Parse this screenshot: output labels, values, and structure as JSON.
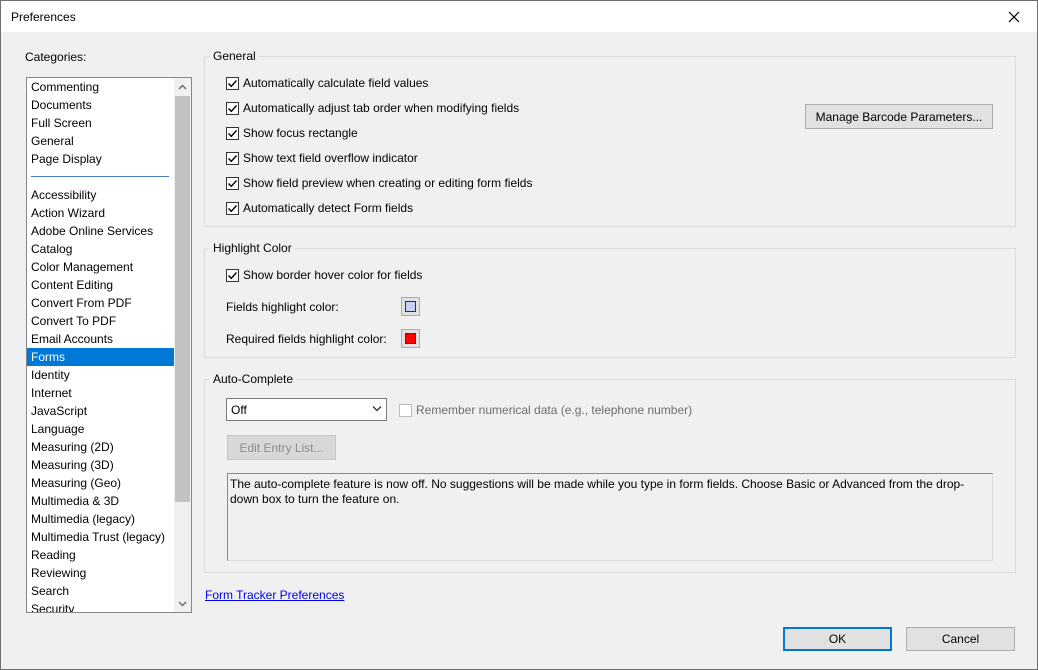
{
  "window": {
    "title": "Preferences"
  },
  "categories": {
    "label": "Categories:",
    "group1": [
      "Commenting",
      "Documents",
      "Full Screen",
      "General",
      "Page Display"
    ],
    "group2": [
      "Accessibility",
      "Action Wizard",
      "Adobe Online Services",
      "Catalog",
      "Color Management",
      "Content Editing",
      "Convert From PDF",
      "Convert To PDF",
      "Email Accounts",
      "Forms",
      "Identity",
      "Internet",
      "JavaScript",
      "Language",
      "Measuring (2D)",
      "Measuring (3D)",
      "Measuring (Geo)",
      "Multimedia & 3D",
      "Multimedia (legacy)",
      "Multimedia Trust (legacy)",
      "Reading",
      "Reviewing",
      "Search",
      "Security"
    ],
    "selected": "Forms"
  },
  "general": {
    "title": "General",
    "options": [
      {
        "label": "Automatically calculate field values",
        "checked": true
      },
      {
        "label": "Automatically adjust tab order when modifying fields",
        "checked": true
      },
      {
        "label": "Show focus rectangle",
        "checked": true
      },
      {
        "label": "Show text field overflow indicator",
        "checked": true
      },
      {
        "label": "Show field preview when creating or editing form fields",
        "checked": true
      },
      {
        "label": "Automatically detect Form fields",
        "checked": true
      }
    ],
    "barcode_button": "Manage Barcode Parameters..."
  },
  "highlight": {
    "title": "Highlight Color",
    "border_hover_label": "Show border hover color for fields",
    "border_hover_checked": true,
    "fields_color_label": "Fields highlight color:",
    "fields_color": "#c6d2f5",
    "required_color_label": "Required fields highlight color:",
    "required_color": "#ff0000"
  },
  "autocomplete": {
    "title": "Auto-Complete",
    "mode": "Off",
    "remember_label": "Remember numerical data (e.g., telephone number)",
    "remember_checked": false,
    "edit_button": "Edit Entry List...",
    "description": "The auto-complete feature is now off. No suggestions will be made while you type in form fields. Choose Basic or Advanced from the drop-down box to turn the feature on."
  },
  "form_tracker_link": "Form Tracker Preferences",
  "footer": {
    "ok": "OK",
    "cancel": "Cancel"
  },
  "colors": {
    "selection": "#0078d7",
    "link": "#0000ee"
  }
}
